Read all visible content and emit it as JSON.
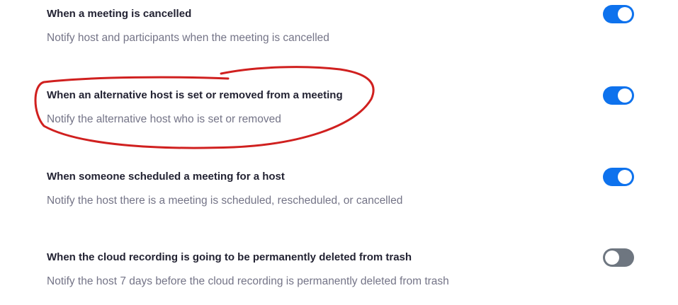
{
  "settings": [
    {
      "title": "When a meeting is cancelled",
      "description": "Notify host and participants when the meeting is cancelled",
      "enabled": true
    },
    {
      "title": "When an alternative host is set or removed from a meeting",
      "description": "Notify the alternative host who is set or removed",
      "enabled": true
    },
    {
      "title": "When someone scheduled a meeting for a host",
      "description": "Notify the host there is a meeting is scheduled, rescheduled, or cancelled",
      "enabled": true
    },
    {
      "title": "When the cloud recording is going to be permanently deleted from trash",
      "description": "Notify the host 7 days before the cloud recording is permanently deleted from trash",
      "enabled": false
    }
  ],
  "colors": {
    "toggle_on": "#0e72ed",
    "toggle_off": "#6e7680",
    "annotation": "#d0201f",
    "title_text": "#232333",
    "description_text": "#747487"
  }
}
